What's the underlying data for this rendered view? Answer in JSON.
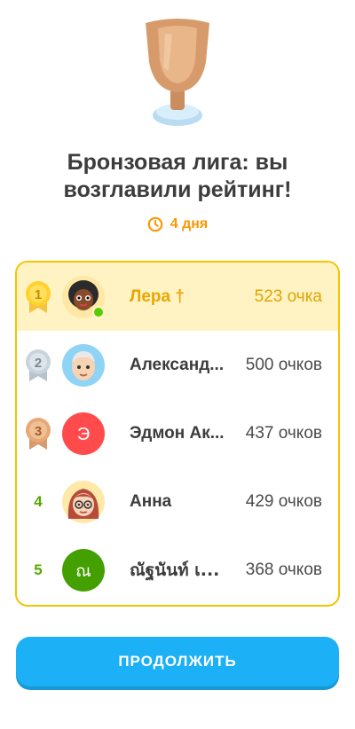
{
  "header": {
    "trophy_icon": "bronze-trophy-icon",
    "title_line1": "Бронзовая лига: вы",
    "title_line2": "возглавили рейтинг!",
    "time_left": "4 дня",
    "accent_color": "#ff9600"
  },
  "leaderboard": [
    {
      "rank": "1",
      "name": "Лера †",
      "points": "523 очка",
      "highlight": true,
      "online": true
    },
    {
      "rank": "2",
      "name": "Александ...",
      "points": "500 очков"
    },
    {
      "rank": "3",
      "name": "Эдмон Ак...",
      "points": "437 очков",
      "avatar_letter": "Э"
    },
    {
      "rank": "4",
      "name": "Анна",
      "points": "429 очков"
    },
    {
      "rank": "5",
      "name": "ณัฐนันท์ เ...",
      "points": "368 очков",
      "avatar_letter": "ณ"
    }
  ],
  "footer": {
    "continue_label": "ПРОДОЛЖИТЬ",
    "button_color": "#1cb0f6"
  }
}
